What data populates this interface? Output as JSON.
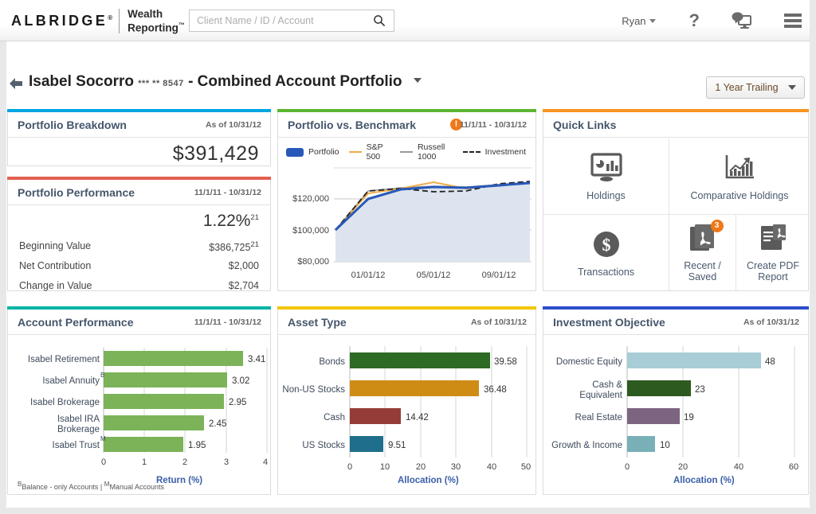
{
  "header": {
    "brand_primary": "ALBRIDGE",
    "brand_tm": "®",
    "brand_line1": "Wealth",
    "brand_line2": "Reporting",
    "brand_line2_tm": "™",
    "search_placeholder": "Client Name / ID / Account",
    "search_value": "",
    "search_icon": "search-icon",
    "user_name": "Ryan",
    "help_icon": "question-mark-icon",
    "chat_icon": "chat-monitor-icon",
    "menu_icon": "hamburger-menu-icon"
  },
  "breadcrumb": {
    "back_icon": "back-arrow-icon",
    "client_name": "Isabel Socorro",
    "account_mask": "*** ** 8547",
    "separator": "-",
    "view_name": "Combined Account Portfolio",
    "period_label": "1 Year Trailing"
  },
  "colors": {
    "accent_breakdown": "#00a6e2",
    "accent_performance": "#e2604f",
    "accent_benchmark": "#5cb531",
    "accent_quicklinks": "#f7941e",
    "accent_account_perf": "#00b4a6",
    "accent_asset_type": "#f2c500",
    "accent_invest_obj": "#2b4fc8",
    "brand_orange": "#f07818",
    "axis_title_blue": "#3a5fa8"
  },
  "panels": {
    "breakdown": {
      "title": "Portfolio Breakdown",
      "date": "As of 10/31/12",
      "total_value": "$391,429"
    },
    "performance": {
      "title": "Portfolio Performance",
      "date": "11/1/11 - 10/31/12",
      "return_pct": "1.22%",
      "return_sup": "21",
      "rows": [
        {
          "label": "Beginning Value",
          "value": "$386,725",
          "sup": "21"
        },
        {
          "label": "Net Contribution",
          "value": "$2,000",
          "sup": ""
        },
        {
          "label": "Change in Value",
          "value": "$2,704",
          "sup": ""
        }
      ]
    },
    "benchmark": {
      "title": "Portfolio vs. Benchmark",
      "date": "11/1/11 - 10/31/12",
      "info_icon": "info-alert-icon",
      "info_glyph": "!"
    },
    "quicklinks": {
      "title": "Quick Links",
      "items": [
        {
          "label": "Holdings",
          "icon": "monitor-chart-icon",
          "badge": ""
        },
        {
          "label": "Comparative Holdings",
          "icon": "bar-chart-arrow-icon",
          "badge": ""
        },
        {
          "label": "Transactions",
          "icon": "dollar-circle-icon",
          "badge": ""
        },
        {
          "label": "Recent /\nSaved",
          "label_l1": "Recent /",
          "label_l2": "Saved",
          "icon": "pdf-document-icon",
          "badge": "3"
        },
        {
          "label": "Create PDF Report",
          "label_l1": "Create PDF",
          "label_l2": "Report",
          "icon": "pdf-create-icon",
          "badge": ""
        }
      ]
    },
    "account_performance": {
      "title": "Account Performance",
      "date": "11/1/11 - 10/31/12",
      "footnote_b_sup": "B",
      "footnote_b": "Balance - only Accounts |",
      "footnote_m_sup": "M",
      "footnote_m": "Manual Accounts"
    },
    "asset_type": {
      "title": "Asset Type",
      "date": "As of 10/31/12"
    },
    "investment_objective": {
      "title": "Investment Objective",
      "date": "As of 10/31/12"
    }
  },
  "chart_data": [
    {
      "id": "portfolio-vs-benchmark",
      "type": "line",
      "title": "Portfolio vs. Benchmark",
      "subtitle": "11/1/11 - 10/31/12",
      "xlabel": "",
      "ylabel": "",
      "ylim": [
        80000,
        133000
      ],
      "yticks": [
        80000,
        100000,
        120000
      ],
      "ytick_labels": [
        "$80,000",
        "$100,000",
        "$120,000"
      ],
      "x": [
        "11/01/11",
        "01/01/12",
        "03/01/12",
        "05/01/12",
        "07/01/12",
        "09/01/12",
        "10/31/12"
      ],
      "xticks": [
        "01/01/12",
        "05/01/12",
        "09/01/12"
      ],
      "grid": true,
      "legend_position": "top",
      "series": [
        {
          "name": "Portfolio",
          "color": "#2859b8",
          "style": "area",
          "values": [
            100000,
            119800,
            125900,
            127100,
            126800,
            128300,
            129600
          ]
        },
        {
          "name": "S&P 500",
          "color": "#efab49",
          "style": "line",
          "values": [
            100000,
            123200,
            126600,
            130200,
            126900,
            128100,
            129900
          ]
        },
        {
          "name": "Russell 1000",
          "color": "#9a9a9a",
          "style": "line",
          "values": [
            100000,
            124400,
            126300,
            127200,
            126600,
            128400,
            130200
          ]
        },
        {
          "name": "Investment",
          "color": "#222222",
          "style": "dashed",
          "values": [
            100000,
            124400,
            126200,
            125100,
            125400,
            128600,
            130600
          ]
        }
      ]
    },
    {
      "id": "account-performance",
      "type": "bar",
      "orientation": "horizontal",
      "title": "Account Performance",
      "subtitle": "11/1/11 - 10/31/12",
      "xlabel": "Return (%)",
      "ylabel": "",
      "xlim": [
        0,
        4
      ],
      "xticks": [
        0,
        1,
        2,
        3,
        4
      ],
      "xtick_labels": [
        "0",
        "1",
        "2",
        "3",
        "4"
      ],
      "bar_color": "#7cb359",
      "categories": [
        "Isabel Retirement",
        "Isabel Annuity",
        "Isabel Brokerage",
        "Isabel IRA Brokerage",
        "Isabel Trust"
      ],
      "category_sups": [
        "",
        "B",
        "",
        "",
        "M"
      ],
      "category_lines": [
        [
          "Isabel Retirement"
        ],
        [
          "Isabel Annuity"
        ],
        [
          "Isabel Brokerage"
        ],
        [
          "Isabel IRA",
          "Brokerage"
        ],
        [
          "Isabel Trust"
        ]
      ],
      "values": [
        3.41,
        3.02,
        2.95,
        2.45,
        1.95
      ],
      "value_labels": [
        "3.41",
        "3.02",
        "2.95",
        "2.45",
        "1.95"
      ]
    },
    {
      "id": "asset-type",
      "type": "bar",
      "orientation": "horizontal",
      "title": "Asset Type",
      "subtitle": "As of 10/31/12",
      "xlabel": "Allocation (%)",
      "ylabel": "",
      "xlim": [
        0,
        50
      ],
      "xticks": [
        0,
        10,
        20,
        30,
        40,
        50
      ],
      "xtick_labels": [
        "0",
        "10",
        "20",
        "30",
        "40",
        "50"
      ],
      "categories": [
        "Bonds",
        "Non-US Stocks",
        "Cash",
        "US Stocks"
      ],
      "values": [
        39.58,
        36.48,
        14.42,
        9.51
      ],
      "value_labels": [
        "39.58",
        "36.48",
        "14.42",
        "9.51"
      ],
      "bar_colors": [
        "#2d6a23",
        "#cf8c14",
        "#963c38",
        "#1e6e8c"
      ]
    },
    {
      "id": "investment-objective",
      "type": "bar",
      "orientation": "horizontal",
      "title": "Investment Objective",
      "subtitle": "As of 10/31/12",
      "xlabel": "Allocation (%)",
      "ylabel": "",
      "xlim": [
        0,
        60
      ],
      "xticks": [
        0,
        20,
        40,
        60
      ],
      "xtick_labels": [
        "0",
        "20",
        "40",
        "60"
      ],
      "categories": [
        "Domestic Equity",
        "Cash & Equivalent",
        "Real Estate",
        "Growth & Income"
      ],
      "category_lines": [
        [
          "Domestic Equity"
        ],
        [
          "Cash &",
          "Equivalent"
        ],
        [
          "Real Estate"
        ],
        [
          "Growth & Income"
        ]
      ],
      "values": [
        48,
        23,
        19,
        10
      ],
      "value_labels": [
        "48",
        "23",
        "19",
        "10"
      ],
      "bar_colors": [
        "#a8cdd6",
        "#2d5a1e",
        "#7d6480",
        "#79b0b8"
      ]
    }
  ]
}
